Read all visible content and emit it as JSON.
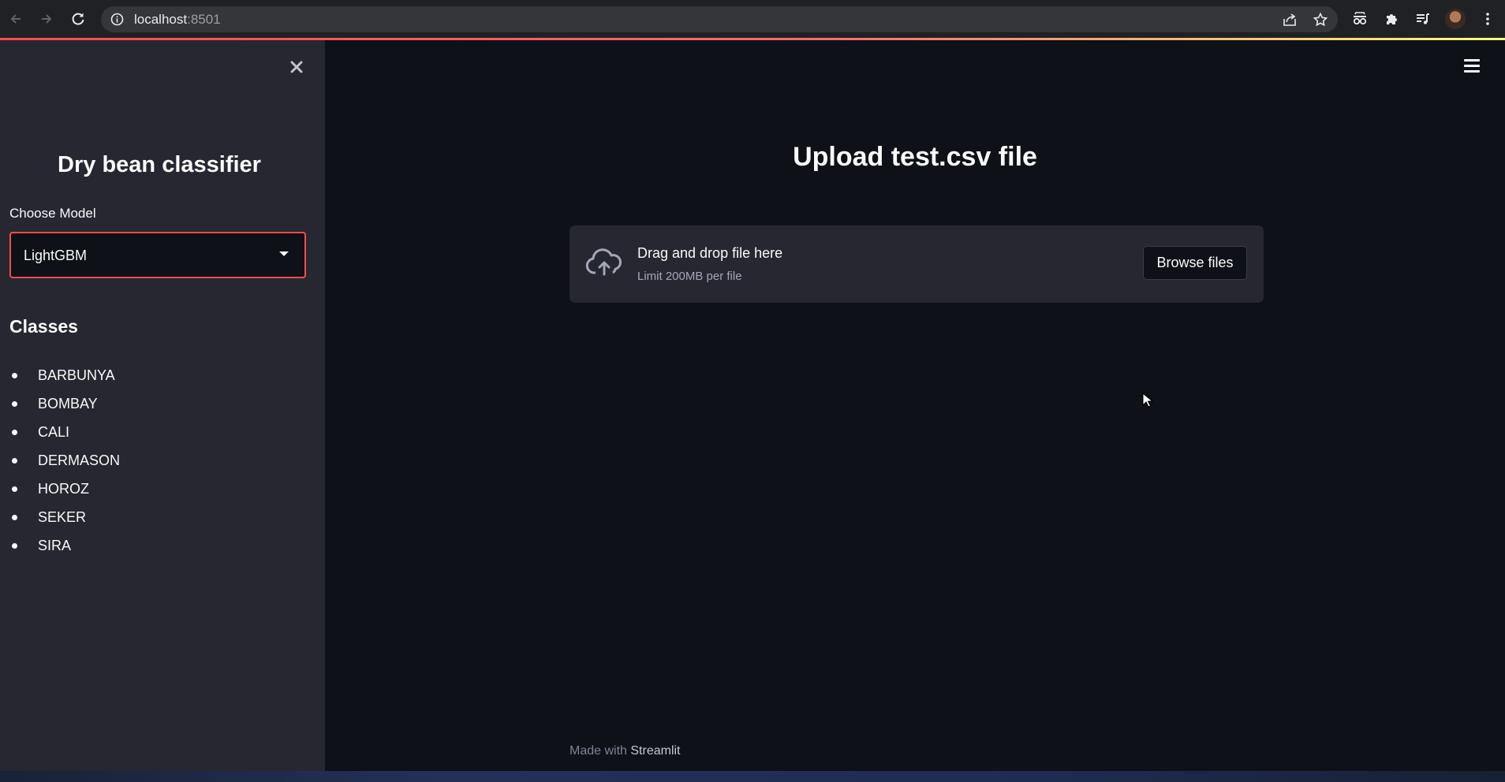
{
  "browser": {
    "url_host": "localhost",
    "url_port": ":8501"
  },
  "sidebar": {
    "title": "Dry bean classifier",
    "model_label": "Choose Model",
    "model_selected": "LightGBM",
    "classes_heading": "Classes",
    "classes": [
      "BARBUNYA",
      "BOMBAY",
      "CALI",
      "DERMASON",
      "HOROZ",
      "SEKER",
      "SIRA"
    ]
  },
  "main": {
    "title": "Upload test.csv file",
    "uploader": {
      "drag_text": "Drag and drop file here",
      "limit_text": "Limit 200MB per file",
      "browse_label": "Browse files"
    },
    "footer": {
      "prefix": "Made with ",
      "brand": "Streamlit"
    }
  },
  "colors": {
    "accent": "#ff4b4b",
    "background": "#0e1117",
    "sidebar_bg": "#262730",
    "text": "#fafafa"
  },
  "icons": {
    "back": "arrow-left-icon",
    "forward": "arrow-right-icon",
    "reload": "reload-icon",
    "info": "info-icon",
    "share": "share-icon",
    "bookmark": "star-icon",
    "incognito": "glasses-icon",
    "extensions": "puzzle-icon",
    "media": "media-queue-icon",
    "menu": "kebab-menu-icon",
    "close": "close-icon",
    "hamburger": "hamburger-menu-icon",
    "upload": "cloud-upload-icon"
  }
}
